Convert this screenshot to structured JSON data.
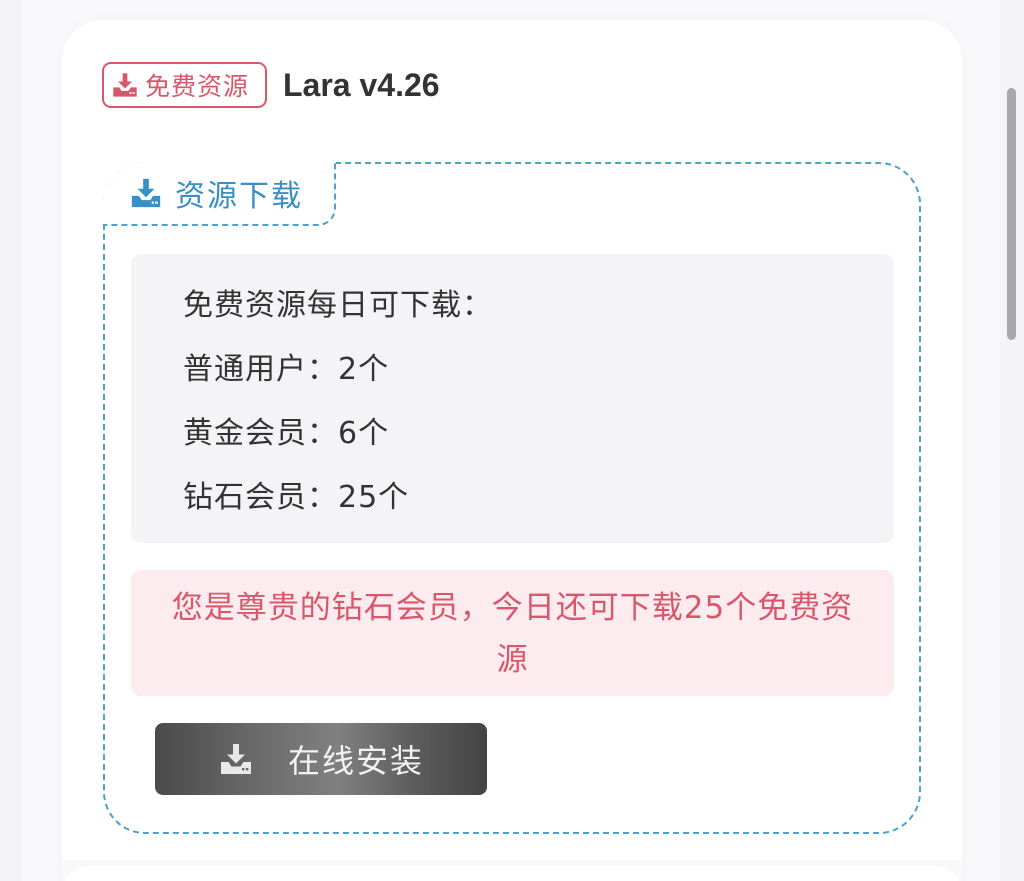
{
  "header": {
    "badge_label": "免费资源",
    "badge_icon": "download-tray-icon",
    "title": "Lara v4.26"
  },
  "download_section": {
    "tab_label": "资源下载",
    "tab_icon": "download-tray-icon",
    "info_lines": [
      "免费资源每日可下载：",
      "普通用户：2个",
      "黄金会员：6个",
      "钻石会员：25个"
    ],
    "notice": "您是尊贵的钻石会员，今日还可下载25个免费资源",
    "install_button_label": "在线安装",
    "install_button_icon": "download-tray-icon"
  },
  "colors": {
    "accent_red": "#d9576a",
    "accent_blue": "#3a8fc4",
    "notice_bg": "#fdecef",
    "info_bg": "#f4f4f6"
  }
}
